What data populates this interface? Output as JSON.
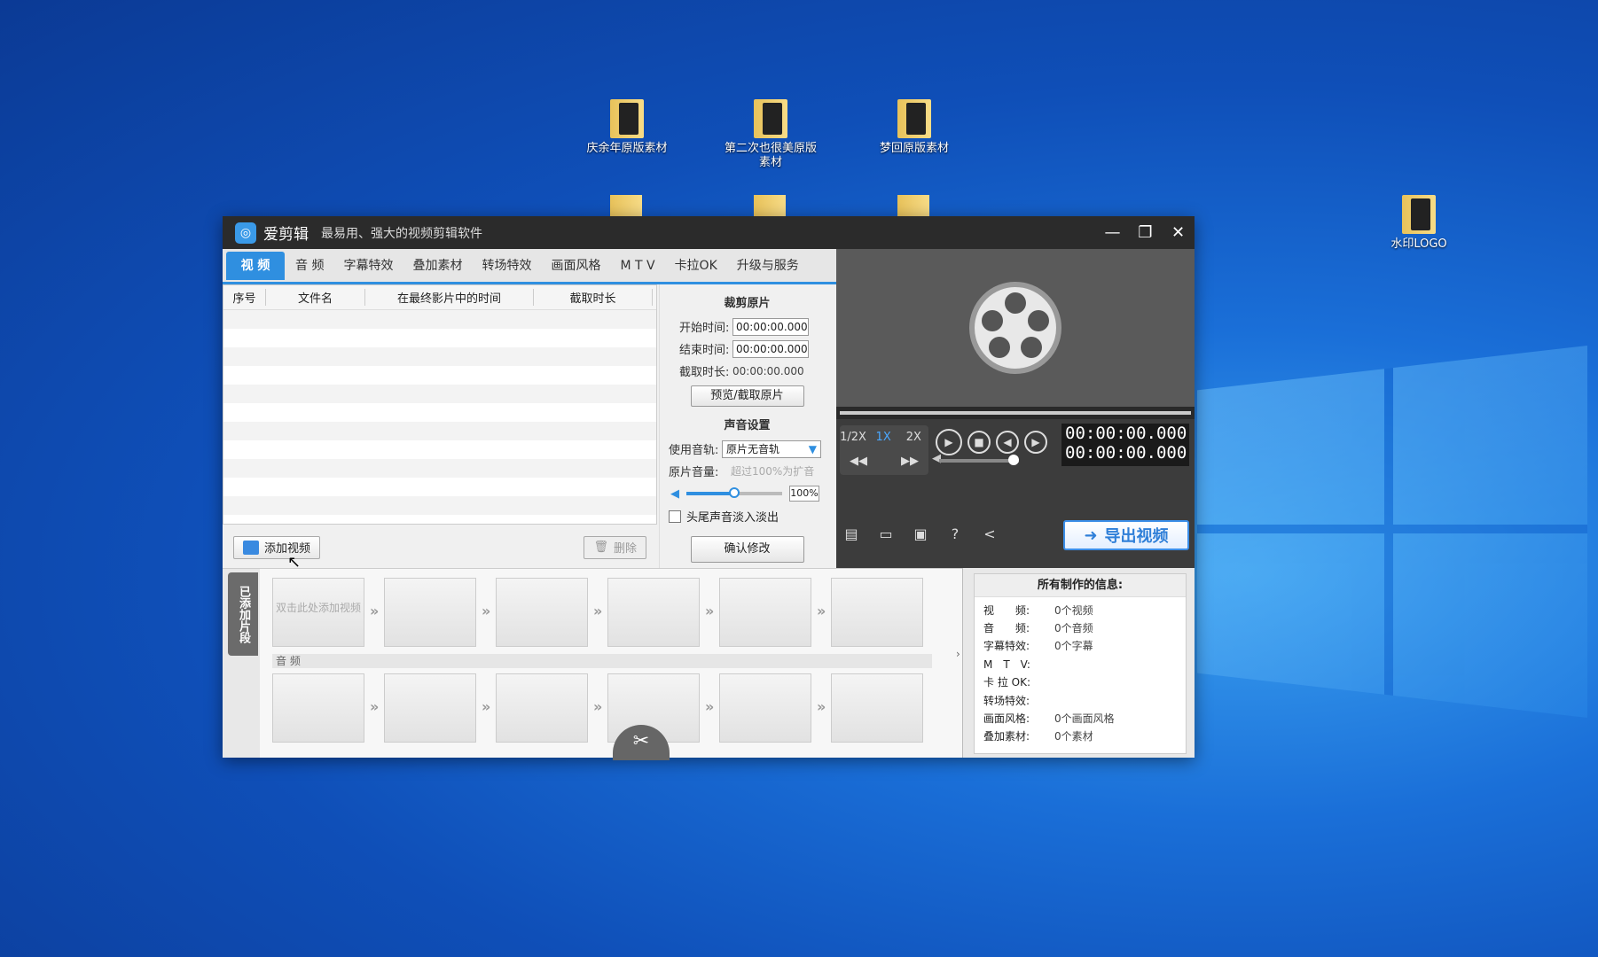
{
  "desktop": {
    "icons": [
      {
        "label": "庆余年原版素材"
      },
      {
        "label": "第二次也很美原版素材"
      },
      {
        "label": "梦回原版素材"
      },
      {
        "label": "水印LOGO"
      }
    ]
  },
  "window": {
    "title": "爱剪辑",
    "subtitle": "最易用、强大的视频剪辑软件",
    "min_label": "—",
    "max_label": "❐",
    "close_label": "✕"
  },
  "tabs": [
    "视 频",
    "音 频",
    "字幕特效",
    "叠加素材",
    "转场特效",
    "画面风格",
    "M T V",
    "卡拉OK",
    "升级与服务"
  ],
  "list": {
    "headers": [
      "序号",
      "文件名",
      "在最终影片中的时间",
      "截取时长"
    ],
    "add_button": "添加视频",
    "delete_button": "删除"
  },
  "clip_settings": {
    "section_clip": "裁剪原片",
    "start_label": "开始时间:",
    "start_value": "00:00:00.000",
    "end_label": "结束时间:",
    "end_value": "00:00:00.000",
    "duration_label": "截取时长:",
    "duration_value": "00:00:00.000",
    "preview_button": "预览/截取原片",
    "section_audio": "声音设置",
    "track_label": "使用音轨:",
    "track_value": "原片无音轨",
    "volume_label": "原片音量:",
    "volume_hint": "超过100%为扩音",
    "volume_value": "100%",
    "volume_level": 0.5,
    "fade_label": "头尾声音淡入淡出",
    "confirm_button": "确认修改"
  },
  "player": {
    "speeds": [
      "1/2X",
      "1X",
      "2X"
    ],
    "time_current": "00:00:00.000",
    "time_total": "00:00:00.000",
    "export_label": "导出视频"
  },
  "timeline": {
    "side_tag": "已添加片段",
    "placeholder": "双击此处添加视频",
    "audio_label": "音 频"
  },
  "info": {
    "title": "所有制作的信息:",
    "rows": [
      {
        "k": "视　　频:",
        "v": "0个视频"
      },
      {
        "k": "音　　频:",
        "v": "0个音频"
      },
      {
        "k": "字幕特效:",
        "v": "0个字幕"
      },
      {
        "k": "M　T　V:",
        "v": ""
      },
      {
        "k": "卡 拉 OK:",
        "v": ""
      },
      {
        "k": "转场特效:",
        "v": ""
      },
      {
        "k": "画面风格:",
        "v": "0个画面风格"
      },
      {
        "k": "叠加素材:",
        "v": "0个素材"
      }
    ]
  }
}
